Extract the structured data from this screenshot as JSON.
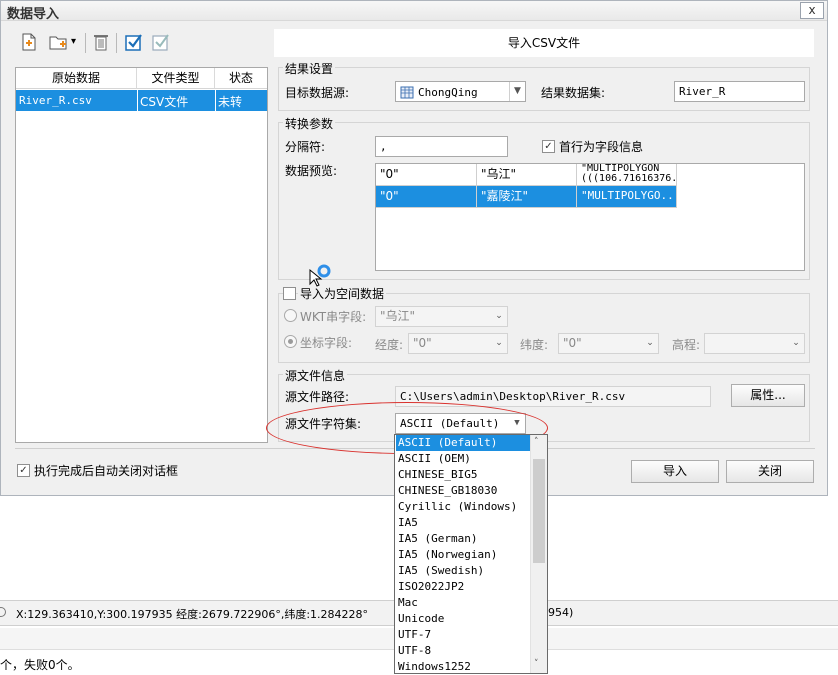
{
  "dialog": {
    "title": "数据导入",
    "close_glyph": "x",
    "header": "导入CSV文件"
  },
  "toolbar": {
    "icons": [
      "add-file-icon",
      "add-folder-icon",
      "delete-icon",
      "select-all-icon",
      "invert-select-icon"
    ],
    "folder_arrow": "▾"
  },
  "source_table": {
    "columns": [
      "原始数据",
      "文件类型",
      "状态"
    ],
    "rows": [
      {
        "name": "River_R.csv",
        "type": "CSV文件",
        "status": "未转"
      }
    ]
  },
  "result_settings": {
    "group_title": "结果设置",
    "target_source_label": "目标数据源:",
    "target_source_value": "ChongQing",
    "result_dataset_label": "结果数据集:",
    "result_dataset_value": "River_R"
  },
  "convert_params": {
    "group_title": "转换参数",
    "separator_label": "分隔符:",
    "separator_value": ",",
    "first_row_header_label": "首行为字段信息",
    "first_row_header_checked": "✓",
    "preview_label": "数据预览:",
    "preview_rows": [
      [
        "\"0\"",
        "\"乌江\"",
        "\"MULTIPOLYGON (((106.71616376..."
      ],
      [
        "\"0\"",
        "\"嘉陵江\"",
        "\"MULTIPOLYGO..."
      ]
    ]
  },
  "spatial": {
    "title": "导入为空间数据",
    "wkt_label": "WKT串字段:",
    "wkt_value": "\"乌江\"",
    "coord_label": "坐标字段:",
    "lon_label": "经度:",
    "lon_value": "\"0\"",
    "lat_label": "纬度:",
    "lat_value": "\"0\"",
    "elev_label": "高程:",
    "elev_value": ""
  },
  "source_info": {
    "group_title": "源文件信息",
    "path_label": "源文件路径:",
    "path_value": "C:\\Users\\admin\\Desktop\\River_R.csv",
    "props_button": "属性...",
    "charset_label": "源文件字符集:",
    "charset_value": "ASCII (Default)"
  },
  "charset_options": [
    "ASCII (Default)",
    "ASCII (OEM)",
    "CHINESE_BIG5",
    "CHINESE_GB18030",
    "Cyrillic (Windows)",
    "IA5",
    "IA5 (German)",
    "IA5 (Norwegian)",
    "IA5 (Swedish)",
    "ISO2022JP2",
    "Mac",
    "Unicode",
    "UTF-7",
    "UTF-8",
    "Windows1252"
  ],
  "footer": {
    "auto_close_label": "执行完成后自动关闭对话框",
    "auto_close_checked": "✓",
    "import_button": "导入",
    "close_button": "关闭"
  },
  "background": {
    "coords": "X:129.363410,Y:300.197935  经度:2679.722906°,纬度:1.284228°",
    "coords_tail": "954)",
    "log": "个，失败0个。"
  },
  "colors": {
    "selection": "#1c8fe0",
    "annotation": "#d9322e"
  }
}
